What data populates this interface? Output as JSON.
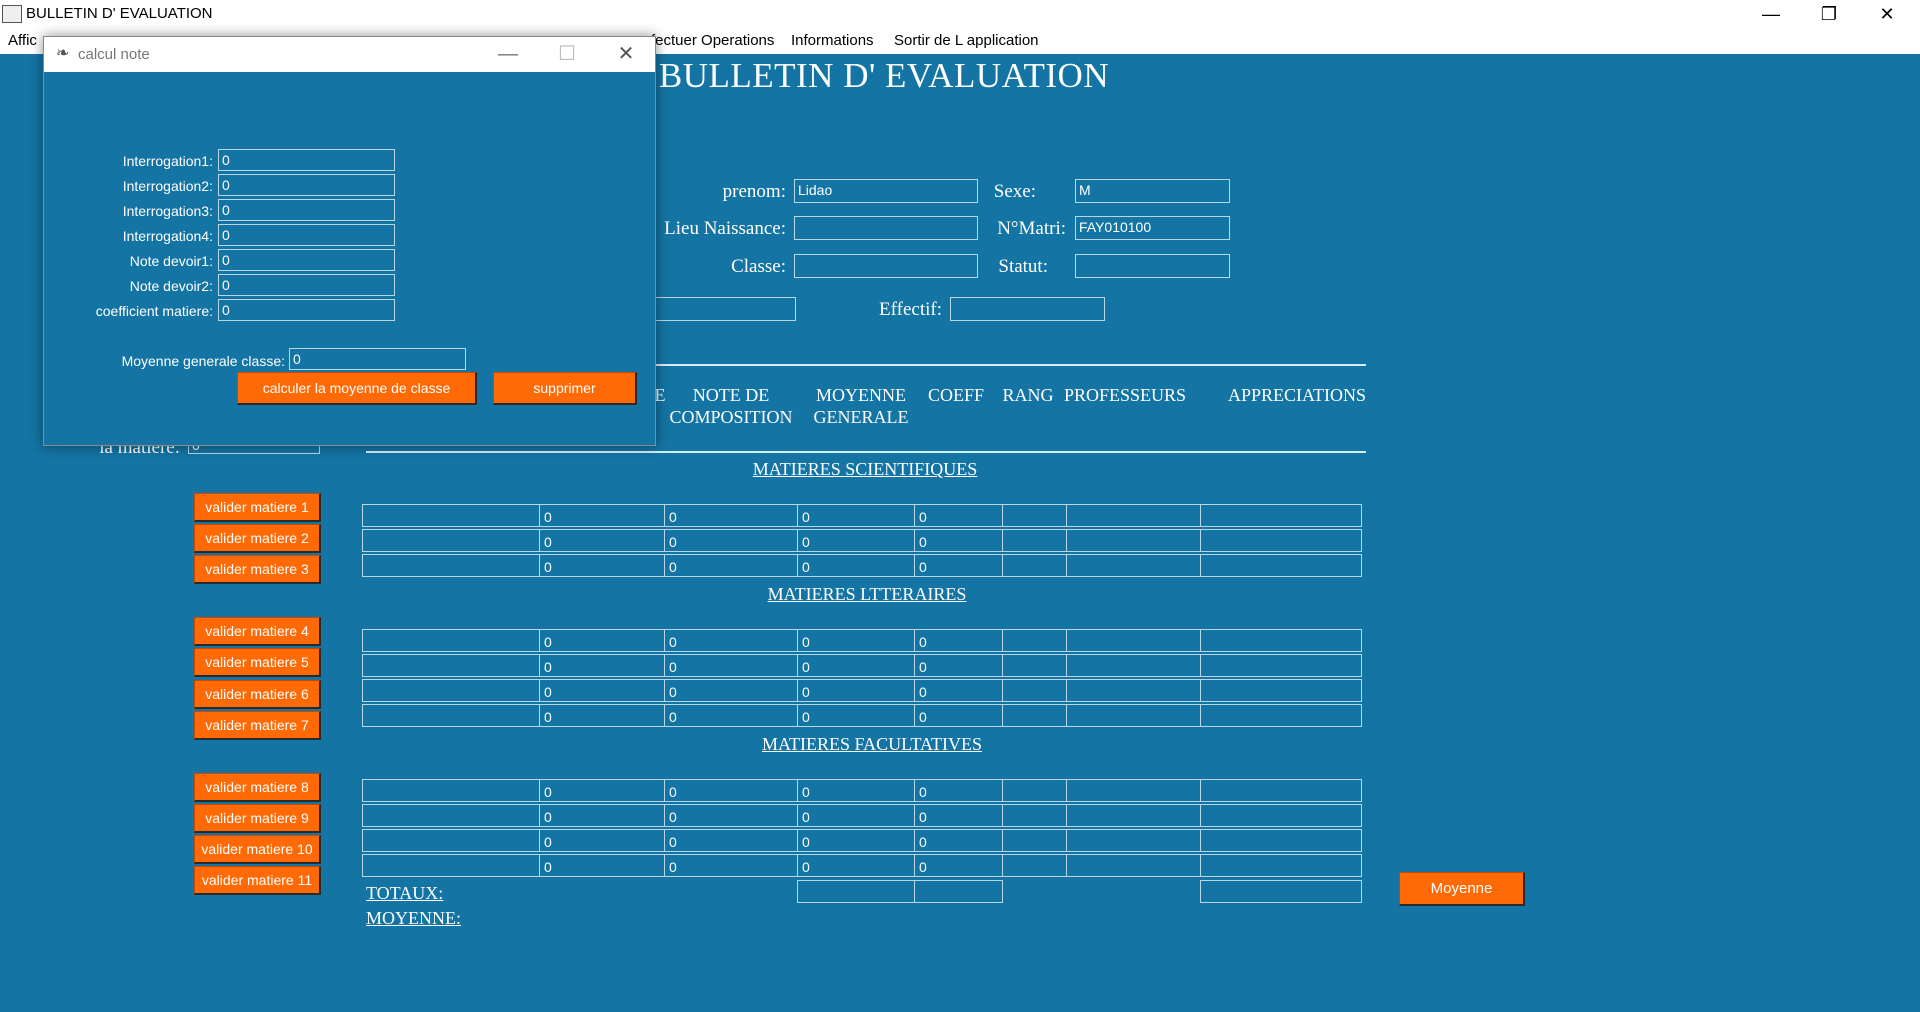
{
  "window": {
    "title": "BULLETIN D' EVALUATION",
    "controls": {
      "minimize": "—",
      "restore": "❐",
      "close": "✕"
    }
  },
  "menu": {
    "items": [
      "Affic",
      "fectuer Operations",
      "Informations",
      "Sortir de L application"
    ]
  },
  "main": {
    "title": "BULLETIN D' EVALUATION",
    "labels": {
      "prenom": "prenom:",
      "lieu_naissance": "Lieu Naissance:",
      "classe": "Classe:",
      "sexe": "Sexe:",
      "nmatri": "N°Matri:",
      "statut": "Statut:",
      "effectif": "Effectif:",
      "la_matiere": "la matiere:"
    },
    "values": {
      "prenom": "Lidao",
      "lieu_naissance": "",
      "classe": "",
      "sexe": "M",
      "nmatri": "FAY010100",
      "statut": "",
      "effectif": "",
      "la_matiere": "0"
    }
  },
  "table": {
    "headers": [
      "E",
      "NOTE DE\nCOMPOSITION",
      "MOYENNE\nGENERALE",
      "COEFF",
      "RANG",
      "PROFESSEURS",
      "APPRECIATIONS"
    ],
    "sections": {
      "scientifiques": "MATIERES SCIENTIFIQUES",
      "litteraires": "MATIERES LTTERAIRES",
      "facultatives": "MATIERES FACULTATIVES"
    },
    "rows": [
      [
        "",
        "0",
        "0",
        "0",
        "0",
        "",
        "",
        ""
      ],
      [
        "",
        "0",
        "0",
        "0",
        "0",
        "",
        "",
        ""
      ],
      [
        "",
        "0",
        "0",
        "0",
        "0",
        "",
        "",
        ""
      ],
      [
        "",
        "0",
        "0",
        "0",
        "0",
        "",
        "",
        ""
      ],
      [
        "",
        "0",
        "0",
        "0",
        "0",
        "",
        "",
        ""
      ],
      [
        "",
        "0",
        "0",
        "0",
        "0",
        "",
        "",
        ""
      ],
      [
        "",
        "0",
        "0",
        "0",
        "0",
        "",
        "",
        ""
      ],
      [
        "",
        "0",
        "0",
        "0",
        "0",
        "",
        "",
        ""
      ],
      [
        "",
        "0",
        "0",
        "0",
        "0",
        "",
        "",
        ""
      ],
      [
        "",
        "0",
        "0",
        "0",
        "0",
        "",
        "",
        ""
      ],
      [
        "",
        "0",
        "0",
        "0",
        "0",
        "",
        "",
        ""
      ]
    ],
    "totaux_label": "TOTAUX:",
    "moyenne_label": "MOYENNE:",
    "totaux_values": [
      "",
      "",
      ""
    ]
  },
  "buttons": {
    "valider": [
      "valider matiere 1",
      "valider matiere 2",
      "valider matiere 3",
      "valider matiere 4",
      "valider matiere 5",
      "valider matiere 6",
      "valider matiere 7",
      "valider matiere 8",
      "valider matiere 9",
      "valider matiere 10",
      "valider matiere 11"
    ],
    "moyenne": "Moyenne"
  },
  "dialog": {
    "title": "calcul note",
    "controls": {
      "minimize": "—",
      "maximize": "☐",
      "close": "✕"
    },
    "fields": [
      {
        "label": "Interrogation1:",
        "value": "0"
      },
      {
        "label": "Interrogation2:",
        "value": "0"
      },
      {
        "label": "Interrogation3:",
        "value": "0"
      },
      {
        "label": "Interrogation4:",
        "value": "0"
      },
      {
        "label": "Note devoir1:",
        "value": "0"
      },
      {
        "label": "Note devoir2:",
        "value": "0"
      },
      {
        "label": "coefficient matiere:",
        "value": "0"
      }
    ],
    "moyenne_label": "Moyenne generale classe:",
    "moyenne_value": "0",
    "calc_button": "calculer la moyenne de classe",
    "delete_button": "supprimer"
  }
}
